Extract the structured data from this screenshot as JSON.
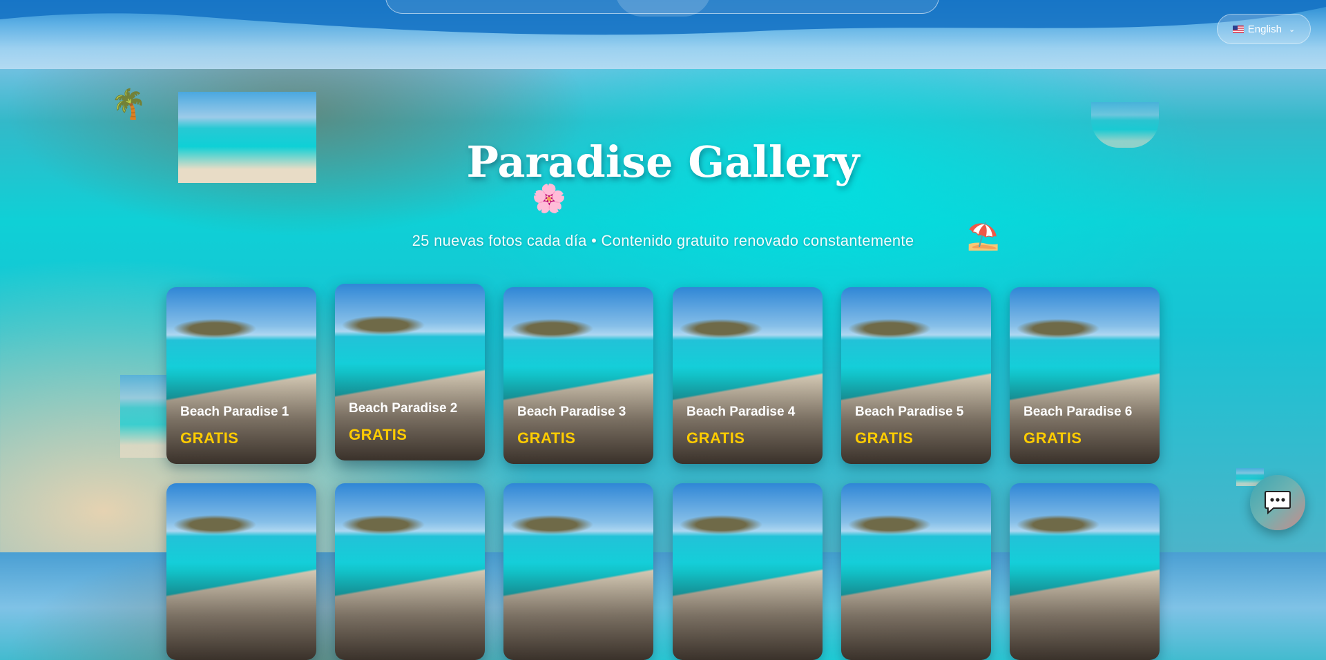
{
  "header": {
    "language_label": "English"
  },
  "hero": {
    "title": "Paradise Gallery",
    "subtitle": "25 nuevas fotos cada día • Contenido gratuito renovado constantemente"
  },
  "gallery": {
    "cards": [
      {
        "name": "Beach Paradise 1",
        "price": "GRATIS"
      },
      {
        "name": "Beach Paradise 2",
        "price": "GRATIS"
      },
      {
        "name": "Beach Paradise 3",
        "price": "GRATIS"
      },
      {
        "name": "Beach Paradise 4",
        "price": "GRATIS"
      },
      {
        "name": "Beach Paradise 5",
        "price": "GRATIS"
      },
      {
        "name": "Beach Paradise 6",
        "price": "GRATIS"
      },
      {
        "name": "",
        "price": ""
      },
      {
        "name": "",
        "price": ""
      },
      {
        "name": "",
        "price": ""
      },
      {
        "name": "",
        "price": ""
      },
      {
        "name": "",
        "price": ""
      },
      {
        "name": "",
        "price": ""
      }
    ]
  },
  "decorations": {
    "emojis": [
      "🌴",
      "🌸",
      "⛱️"
    ]
  },
  "icons": {
    "flag": "us-flag-icon",
    "chevron": "chevron-down-icon",
    "chat": "chat-bubble-icon"
  },
  "colors": {
    "price": "#ffcc00",
    "accent_ocean": "#10d2d9",
    "banner_blue": "#1e84cf"
  }
}
